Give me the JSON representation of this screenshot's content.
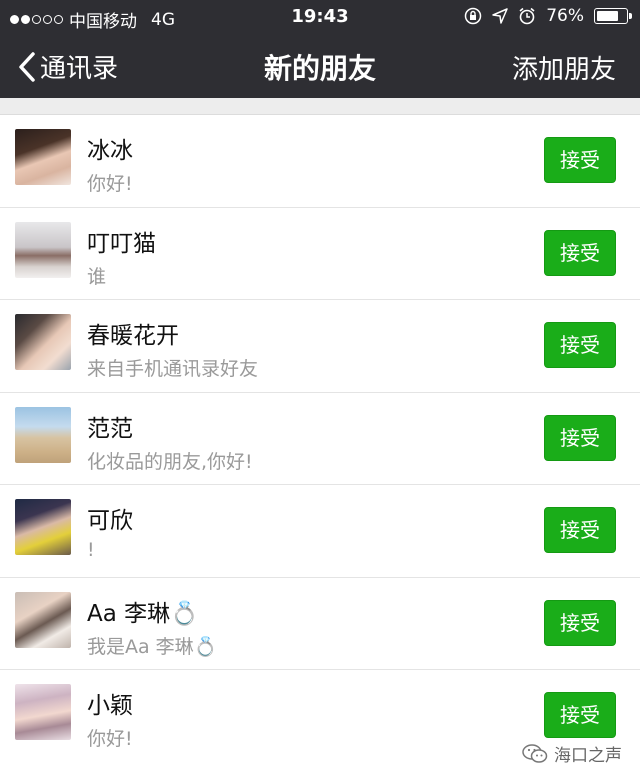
{
  "status_bar": {
    "carrier": "中国移动",
    "network": "4G",
    "time": "19:43",
    "battery": "76%",
    "battery_level": 0.76,
    "signal_bars": 2,
    "signal_total": 5
  },
  "nav": {
    "back_label": "通讯录",
    "title": "新的朋友",
    "right_label": "添加朋友"
  },
  "friend_requests": [
    {
      "name": "冰冰",
      "message": "你好!",
      "accept_label": "接受"
    },
    {
      "name": "叮叮猫",
      "message": "谁",
      "accept_label": "接受"
    },
    {
      "name": "春暖花开",
      "message": "来自手机通讯录好友",
      "accept_label": "接受"
    },
    {
      "name": "范范",
      "message": "化妆品的朋友,你好!",
      "accept_label": "接受"
    },
    {
      "name": "可欣",
      "message": "!",
      "accept_label": "接受"
    },
    {
      "name": "Aa 李琳💍",
      "message": "我是Aa 李琳💍",
      "accept_label": "接受"
    },
    {
      "name": "小颖",
      "message": "你好!",
      "accept_label": "接受"
    }
  ],
  "watermark": "海口之声",
  "colors": {
    "nav_bg": "#2e2e33",
    "accept_green": "#1aad19",
    "page_bg": "#ededed"
  }
}
